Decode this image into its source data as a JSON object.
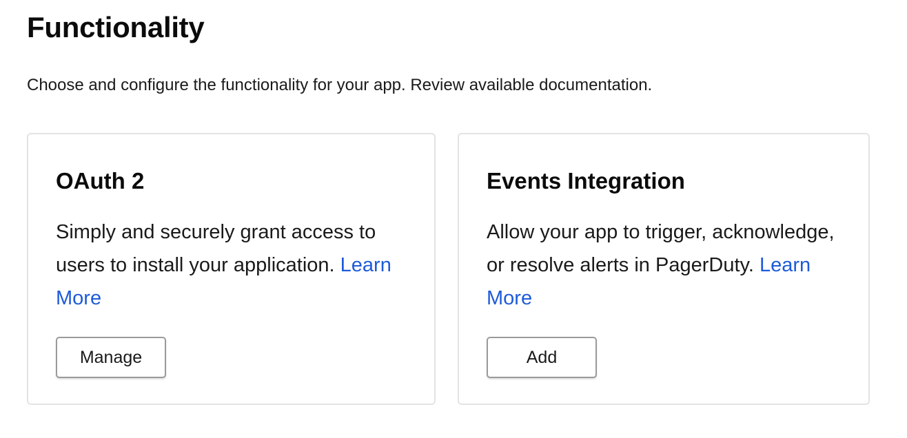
{
  "page": {
    "title": "Functionality",
    "subtitle": "Choose and configure the functionality for your app. Review available documentation."
  },
  "cards": [
    {
      "title": "OAuth 2",
      "description": "Simply and securely grant access to users to install your application.",
      "link_label": "Learn More",
      "button_label": "Manage"
    },
    {
      "title": "Events Integration",
      "description": "Allow your app to trigger, acknowledge, or resolve alerts in PagerDuty.",
      "link_label": "Learn More",
      "button_label": "Add"
    }
  ],
  "colors": {
    "link": "#1e5bd8",
    "card_border": "#e3e3e3",
    "button_border": "#9a9a9a"
  }
}
